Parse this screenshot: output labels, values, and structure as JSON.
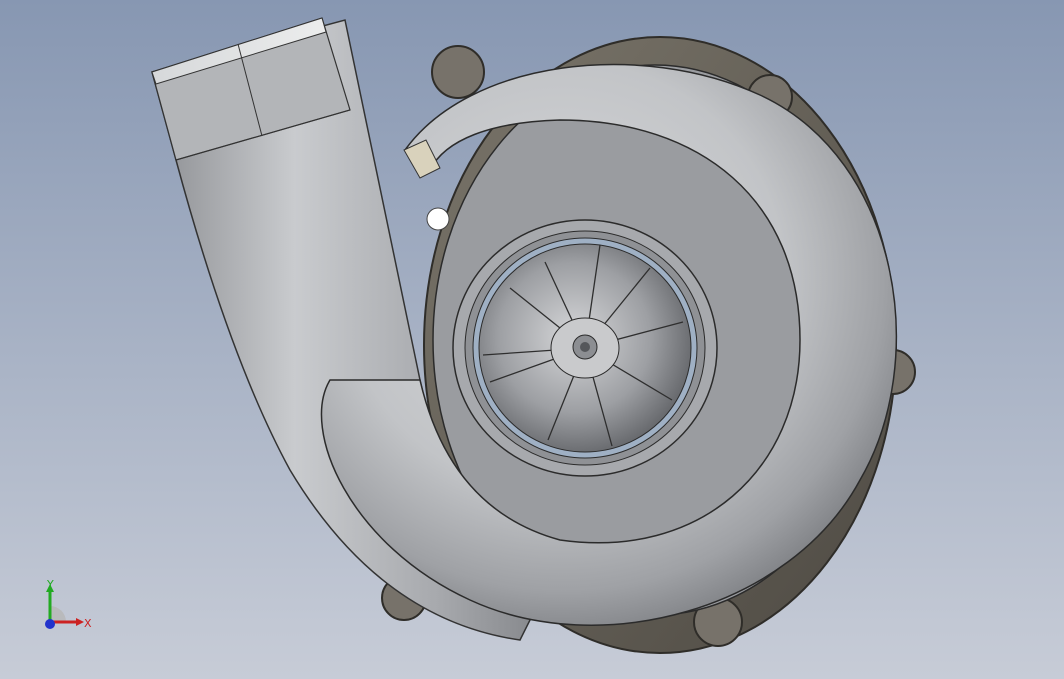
{
  "viewport": {
    "background_top": "#8a9bb5",
    "background_bottom": "#c5cbd6"
  },
  "model": {
    "name_icon": "turbocharger-compressor-housing-model",
    "housing_color": "#b8babd",
    "flange_color": "#6e6a60",
    "wheel_color": "#a8aaae"
  },
  "triad": {
    "x_label": "X",
    "y_label": "Y",
    "x_color": "#cc2222",
    "y_color": "#22aa22",
    "z_color": "#2233cc"
  }
}
